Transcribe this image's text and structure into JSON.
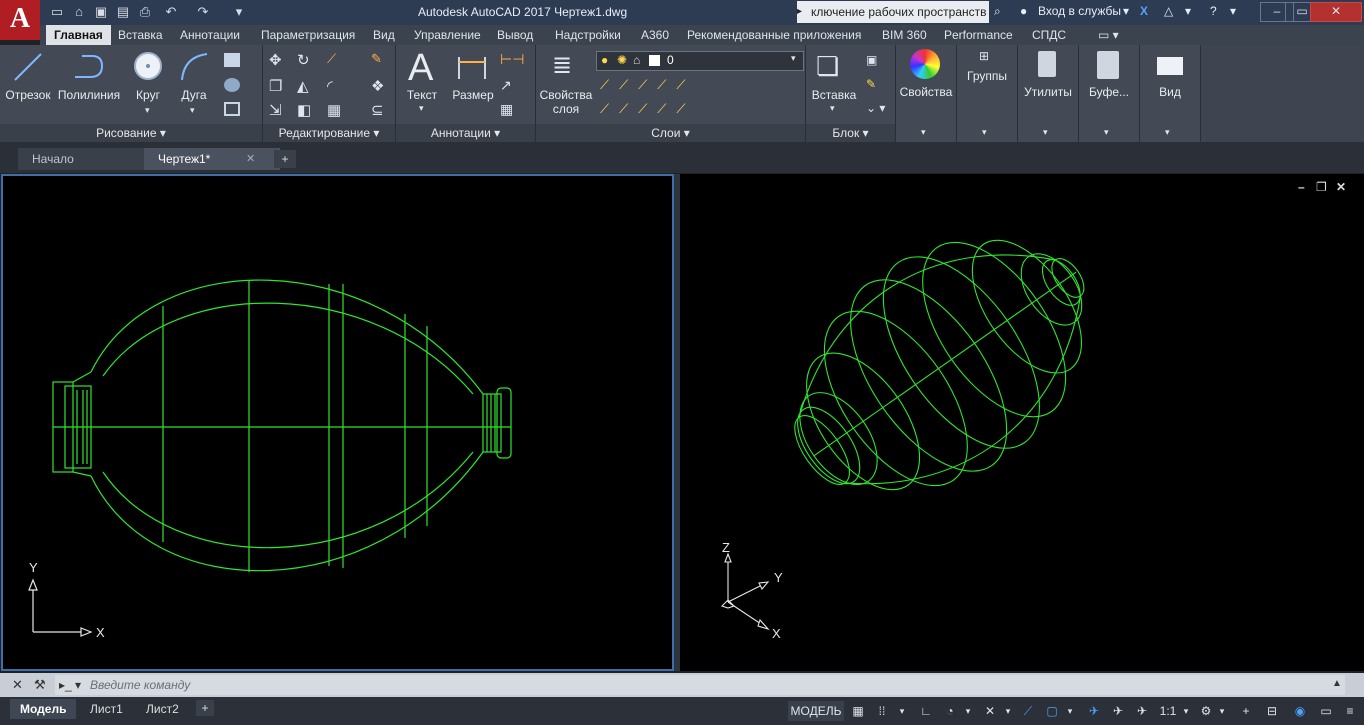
{
  "window": {
    "title": "Autodesk AutoCAD 2017    Чертеж1.dwg",
    "workspace_text": "ключение рабочих пространств",
    "signin_label": "Вход в службы",
    "accent": "#b01e23"
  },
  "ribbon_tabs": [
    "Главная",
    "Вставка",
    "Аннотации",
    "Параметризация",
    "Вид",
    "Управление",
    "Вывод",
    "Надстройки",
    "A360",
    "Рекомендованные приложения",
    "BIM 360",
    "Performance",
    "СПДС"
  ],
  "draw_panel": {
    "title": "Рисование",
    "tools": [
      "Отрезок",
      "Полилиния",
      "Круг",
      "Дуга"
    ]
  },
  "modify_panel": {
    "title": "Редактирование"
  },
  "annotation_panel": {
    "title": "Аннотации",
    "tools": [
      "Текст",
      "Размер"
    ]
  },
  "layers_panel": {
    "title": "Слои",
    "props_line1": "Свойства",
    "props_line2": "слоя",
    "current_layer": "0"
  },
  "block_panel": {
    "title": "Блок",
    "insert_label": "Вставка"
  },
  "extra_panels": [
    "Свойства",
    "Группы",
    "Утилиты",
    "Буфе...",
    "Вид"
  ],
  "doc_tabs": [
    "Начало",
    "Чертеж1*"
  ],
  "viewport_left": {
    "ucs_x": "X",
    "ucs_y": "Y",
    "line_color": "#2ee62e"
  },
  "viewport_right": {
    "ucs_x": "X",
    "ucs_y": "Y",
    "ucs_z": "Z"
  },
  "command_line": {
    "placeholder": "Введите команду"
  },
  "layout_tabs": [
    "Модель",
    "Лист1",
    "Лист2"
  ],
  "status_bar": {
    "model_label": "МОДЕЛЬ",
    "scale_label": "1:1"
  }
}
